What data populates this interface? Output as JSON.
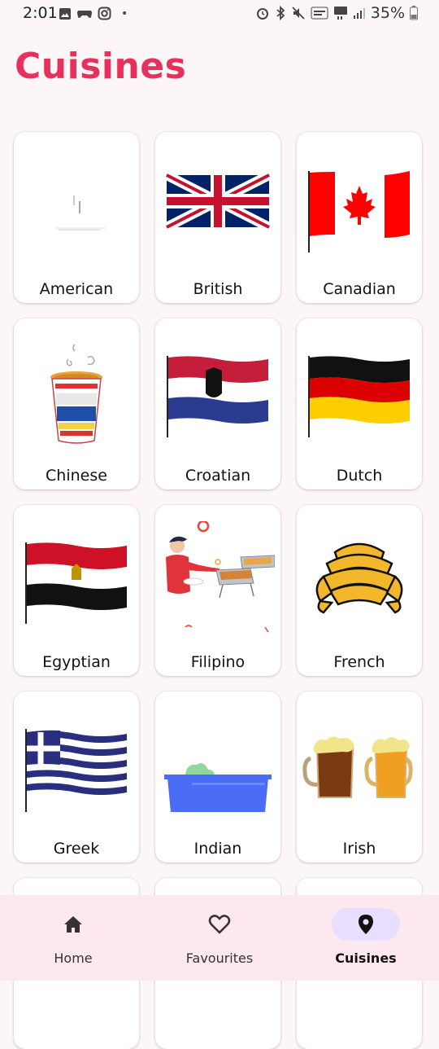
{
  "status_bar": {
    "time": "2:01",
    "dot": "•",
    "battery": "35%",
    "icons_left": [
      "image-icon",
      "gamepad-icon",
      "instagram-icon"
    ],
    "icons_right": [
      "alarm-icon",
      "bluetooth-icon",
      "mute-icon",
      "volte-icon",
      "5g-icon",
      "signal-icon",
      "battery-icon"
    ]
  },
  "page": {
    "title": "Cuisines"
  },
  "cuisines": [
    {
      "label": "American",
      "image": "american-image"
    },
    {
      "label": "British",
      "image": "uk-flag"
    },
    {
      "label": "Canadian",
      "image": "canada-flag"
    },
    {
      "label": "Chinese",
      "image": "noodle-cup"
    },
    {
      "label": "Croatian",
      "image": "croatia-flag"
    },
    {
      "label": "Dutch",
      "image": "germany-flag"
    },
    {
      "label": "Egyptian",
      "image": "egypt-flag"
    },
    {
      "label": "Filipino",
      "image": "chef-illustration"
    },
    {
      "label": "French",
      "image": "croissants"
    },
    {
      "label": "Greek",
      "image": "greece-flag"
    },
    {
      "label": "Indian",
      "image": "planter-box"
    },
    {
      "label": "Irish",
      "image": "beer-mugs"
    }
  ],
  "bottom_nav": {
    "items": [
      {
        "label": "Home",
        "icon": "home-icon",
        "active": false
      },
      {
        "label": "Favourites",
        "icon": "heart-icon",
        "active": false
      },
      {
        "label": "Cuisines",
        "icon": "location-pin-icon",
        "active": true
      }
    ]
  },
  "colors": {
    "title": "#e8315a",
    "background": "#fdf6f9",
    "nav_background": "#fce8ee",
    "nav_active_pill": "#e8deff"
  }
}
